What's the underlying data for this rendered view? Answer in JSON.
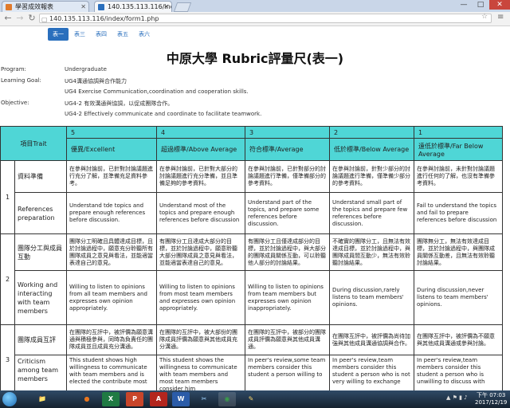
{
  "browser": {
    "tabs": [
      {
        "title": "學習成效報表"
      },
      {
        "title": "140.135.113.116/index/"
      }
    ],
    "url": "140.135.113.116/index/form1.php",
    "window_controls": {
      "minimize": "—",
      "maximize": "□",
      "close": "✕"
    }
  },
  "page": {
    "nav_tabs": [
      "表一",
      "表三",
      "表四",
      "表五",
      "表六"
    ],
    "active_tab": "表一",
    "title": "中原大學 Rubric評量尺(表一)",
    "meta": {
      "program_label": "Program:",
      "program_value": "Undergraduate",
      "goal_label": "Learning Goal:",
      "goal_value_zh": "UG4溝通協調與合作能力",
      "goal_value_en": "UG4 Exercise Communication,coordination and cooperation skills.",
      "objective_label": "Objective:",
      "objective_value_zh": "UG4-2 有效溝通與協調，以促成團隊合作。",
      "objective_value_en": "UG4-2 Effectively communicate and coordinate to facilitate teamwork."
    },
    "table": {
      "trait_header": "項目Trait",
      "levels": [
        {
          "score": "5",
          "label": "優異/Excellent"
        },
        {
          "score": "4",
          "label": "超過標準/Above Average"
        },
        {
          "score": "3",
          "label": "符合標準/Average"
        },
        {
          "score": "2",
          "label": "低於標準/Below Average"
        },
        {
          "score": "1",
          "label": "遠低於標準/Far Below Average"
        }
      ],
      "traits": [
        {
          "number": "1",
          "rows": [
            {
              "criterion": "資料準備",
              "cells": [
                "在參與討論前，已針對討論議題進行充分了解，並準備充足資料參考。",
                "在參與討論前，已針對大部分的討論議題進行充分準備，並且準備足夠的參考資料。",
                "在參與討論前，已針對部分的討論議題進行準備，僅準備部分的參考資料。",
                "在參與討論前，針對少部分的討論議題進行準備，僅準備少部分的參考資料。",
                "在參與討論前，未針對討論議題進行任何的了解，也沒有準備參考資料。"
              ]
            },
            {
              "criterion": "References preparation",
              "cells": [
                "Understand tde topics and prepare enough references before discussion.",
                "Understand most of the topics and prepare enough references before discussion",
                "Understand part of the topics, and prepare some references before discussion.",
                "Understand small part of the topics and prepare few references before discussion.",
                "Fail to understand the topics and fail to prepare references before discussion"
              ]
            }
          ]
        },
        {
          "number": "2",
          "rows": [
            {
              "criterion": "團隊分工與成員互動",
              "cells": [
                "團隊分工明確且具體達成目標，且於討論過程中，願意充分聆聽所有團隊成員之意見與看法，並能適當表達自己的意見。",
                "有團隊分工且達成大部分的目標，並於討論過程中，願意聆聽大部分團隊成員之意見與看法，並能適當表達自己的意見。",
                "有團隊分工且僅達成部分的目標，並於討論過程中，與大部分的團隊成員關係互動，可以聆聽他人部分的討論結果。",
                "不確實的團隊分工，且無法有效達成目標，並於討論過程中，與團隊成員間互動少，無法有效聆聽討論結果。",
                "團隊無分工，無法有效達成目標，並於討論過程中，與團隊成員關係互動差，且無法有效聆聽討論結果。"
              ]
            },
            {
              "criterion": "Working and interacting with team members",
              "cells": [
                "Willing to listen to opinions from all team members and expresses own opinion appropriately.",
                "Willing to listen to opinions from most team members and expresses own opinion appropriately.",
                "Willing to listen to opinions from team members but expresses own opinion inappropriately.",
                "During discussion,rarely listens to team members' opinions.",
                "During discussion,never listens to team members' opinions."
              ]
            }
          ]
        },
        {
          "number": "3",
          "rows": [
            {
              "criterion": "團隊成員互評",
              "cells": [
                "在團隊的互評中，被評價為願意溝通與積極參與，同時為負責任的團隊成員並且成員充分溝通。",
                "在團隊的互評中，被大部份的團隊成員評價為願意與其他成員充分溝通。",
                "在團隊的互評中，被部分的團隊成員評價為願意與其他成員溝通。",
                "在團隊互評中，被評價為尚待加強與其他成員溝通協調與合作。",
                "在團隊互評中，被評價為不願意與其他成員溝通或參與討論。"
              ]
            },
            {
              "criterion": "Criticism among team members",
              "cells": [
                "This student shows high willingness to communicate with team members and is elected the contribute most",
                "This student shows the willingness to communicate with team members and most team members consider him",
                "In peer's review,some team members consider this student a person willing to",
                "In peer's review,team members consider this student a person who is not very willing to exchange",
                "In peer's review,team members consider this student a person who is unwilling to discuss with"
              ]
            }
          ]
        }
      ]
    }
  },
  "taskbar": {
    "apps": [
      {
        "name": "explorer",
        "label": "📁"
      },
      {
        "name": "firefox",
        "label": "●"
      },
      {
        "name": "excel",
        "label": "X"
      },
      {
        "name": "powerpoint",
        "label": "P"
      },
      {
        "name": "pdf",
        "label": "A"
      },
      {
        "name": "word",
        "label": "W"
      },
      {
        "name": "snipping",
        "label": "✂"
      },
      {
        "name": "chrome",
        "label": "◉"
      },
      {
        "name": "paint",
        "label": "✎"
      }
    ],
    "time": "下午 07:03",
    "date": "2017/12/19",
    "colors": {
      "excel": "#1f7a43",
      "powerpoint": "#c8452a",
      "word": "#2b5ca8",
      "firefox": "#e8761f",
      "chrome": "#3a9d4a",
      "pdf": "#b3261e"
    }
  }
}
